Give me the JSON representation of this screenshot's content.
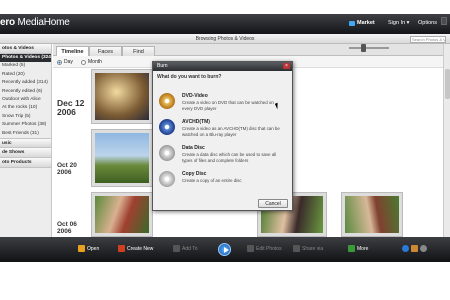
{
  "app": {
    "logo_bold": "ero",
    "logo_light": " MediaHome"
  },
  "header": {
    "market": "Market",
    "sign_in": "Sign In ▾",
    "options": "Options"
  },
  "subbar": {
    "title": "Browsing Photos & Videos",
    "search_placeholder": "Search Photos & V"
  },
  "sidebar": {
    "header": "otos & Videos",
    "items": [
      {
        "label": "Photos & Videos (324)",
        "selected": true
      },
      {
        "label": "Marked (5)"
      },
      {
        "label": "Rated (20)"
      },
      {
        "label": "Recently added (314)"
      },
      {
        "label": "Recently edited (6)"
      },
      {
        "label": "Outdoor with Alice"
      },
      {
        "label": "At the rocks (10)"
      },
      {
        "label": "Snow Trip (5)"
      },
      {
        "label": "Summer Photos (38)"
      },
      {
        "label": "Best Friends (31)"
      }
    ],
    "sections": [
      "usic",
      "de Shows",
      "oto Products"
    ]
  },
  "tabs": [
    {
      "label": "Timeline",
      "active": true
    },
    {
      "label": "Faces"
    },
    {
      "label": "Find"
    }
  ],
  "view": {
    "day": "Day",
    "month": "Month",
    "selected": "Day"
  },
  "timeline": {
    "dates": [
      "Dec 12\n2006",
      "Oct 20\n2006",
      "Oct 06\n2006"
    ]
  },
  "bottombar": {
    "open": "Open",
    "create_new": "Create New",
    "add_to": "Add To",
    "edit_photos": "Edit Photos",
    "share_via": "Share via",
    "more": "More"
  },
  "dialog": {
    "title": "Burn",
    "question": "What do you want to burn?",
    "options": [
      {
        "title": "DVD-Video",
        "desc": "Create a video on DVD that can be watched on every DVD player",
        "icon": "dvd-disc-icon"
      },
      {
        "title": "AVCHD(TM)",
        "desc": "Create a video as an AVCHD(TM) disc that can be watched on a Blu-ray player",
        "icon": "avchd-disc-icon"
      },
      {
        "title": "Data Disc",
        "desc": "Create a data disc which can be used to save all types of files and complete folders",
        "icon": "data-disc-icon"
      },
      {
        "title": "Copy Disc",
        "desc": "Create a copy of an entire disc",
        "icon": "copy-disc-icon"
      }
    ],
    "cancel": "Cancel"
  },
  "colors": {
    "titlebar": "#2b2d31",
    "accent": "#3fa9f5",
    "selected_sidebar": "#2b2c30"
  }
}
